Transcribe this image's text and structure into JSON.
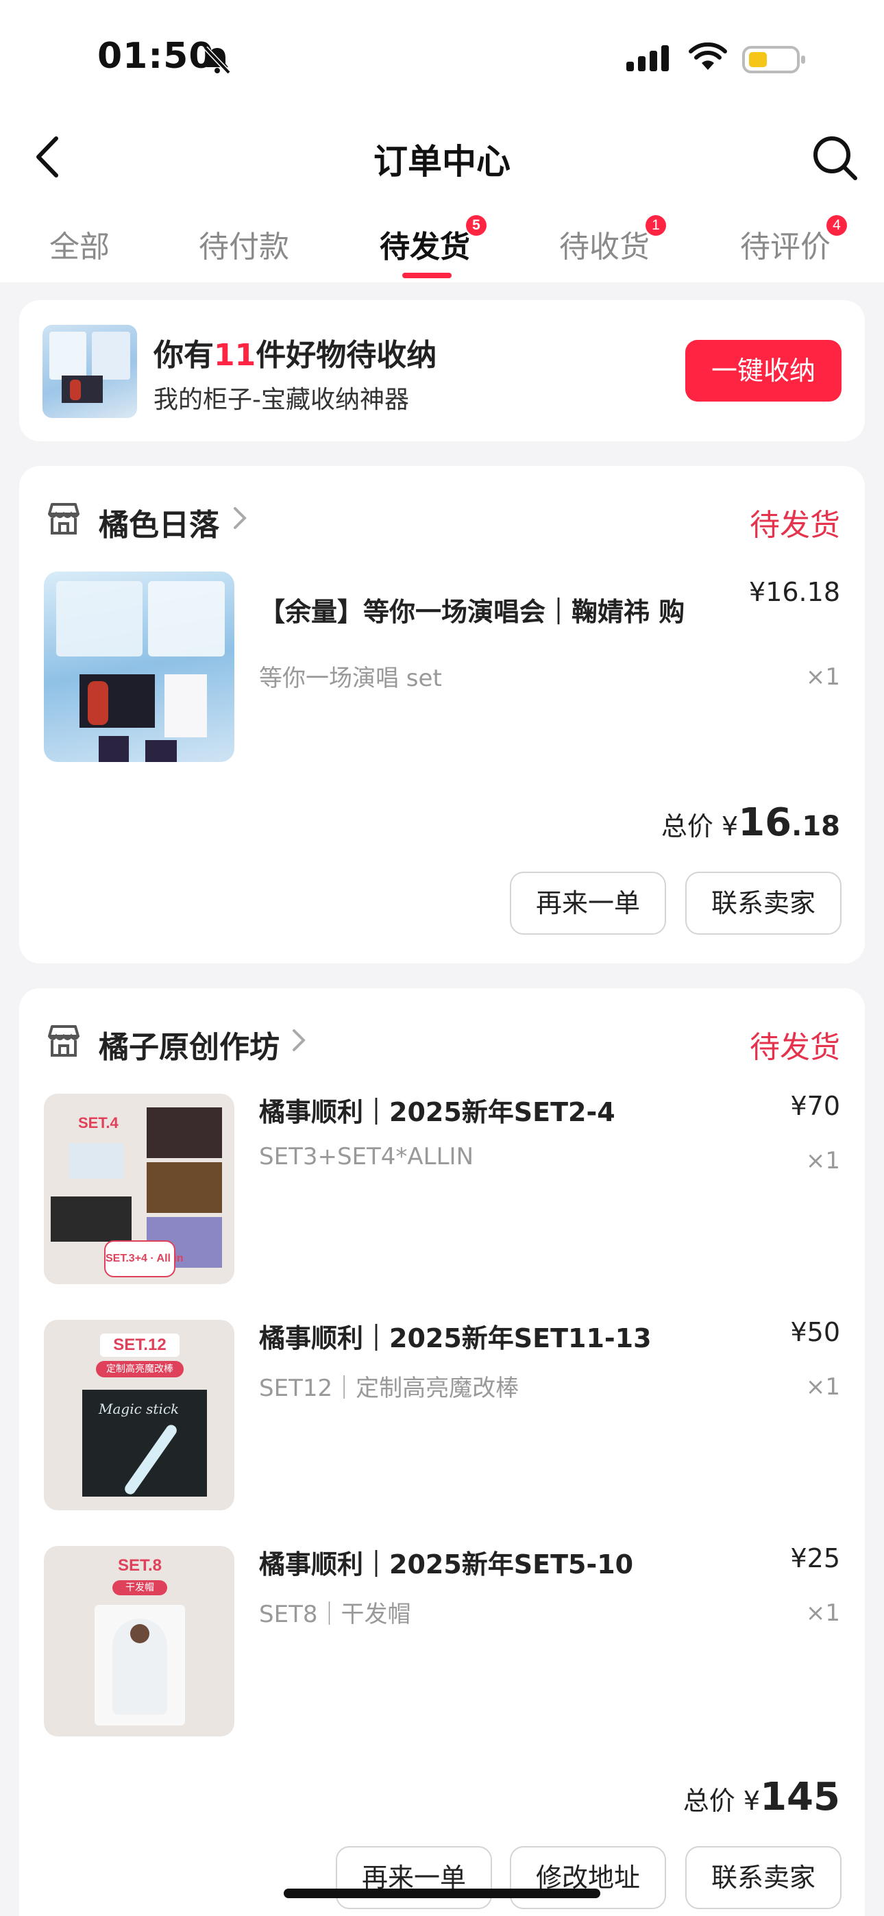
{
  "status_bar": {
    "time": "01:50"
  },
  "header": {
    "title": "订单中心"
  },
  "tabs": [
    {
      "label": "全部",
      "badge": ""
    },
    {
      "label": "待付款",
      "badge": ""
    },
    {
      "label": "待发货",
      "badge": "5"
    },
    {
      "label": "待收货",
      "badge": "1"
    },
    {
      "label": "待评价",
      "badge": "4"
    }
  ],
  "promo": {
    "title_prefix": "你有",
    "title_count": "11",
    "title_suffix": "件好物待收纳",
    "subtitle": "我的柜子-宝藏收纳神器",
    "button": "一键收纳"
  },
  "orders": [
    {
      "shop": "橘色日落",
      "status": "待发货",
      "items": [
        {
          "title": "【余量】等你一场演唱会｜鞠婧祎 购",
          "spec": "等你一场演唱 set",
          "price": "¥16.18",
          "qty": "×1"
        }
      ],
      "total_label": "总价",
      "total_symbol": "¥",
      "total_int": "16",
      "total_dec": ".18",
      "buttons": [
        "再来一单",
        "联系卖家"
      ]
    },
    {
      "shop": "橘子原创作坊",
      "status": "待发货",
      "items": [
        {
          "title": "橘事顺利｜2025新年SET2-4",
          "spec": "SET3+SET4*ALLIN",
          "price": "¥70",
          "qty": "×1",
          "thumb_label": "SET.4",
          "thumb_label2": "SET.3+4 · All in"
        },
        {
          "title": "橘事顺利｜2025新年SET11-13",
          "spec": "SET12｜定制高亮魔改棒",
          "price": "¥50",
          "qty": "×1",
          "thumb_label": "SET.12",
          "thumb_label2": "定制高亮魔改棒",
          "thumb_text": "Magic stick"
        },
        {
          "title": "橘事顺利｜2025新年SET5-10",
          "spec": "SET8｜干发帽",
          "price": "¥25",
          "qty": "×1",
          "thumb_label": "SET.8",
          "thumb_label2": "干发帽"
        }
      ],
      "total_label": "总价",
      "total_symbol": "¥",
      "total_int": "145",
      "buttons": [
        "再来一单",
        "修改地址",
        "联系卖家"
      ]
    }
  ],
  "colors": {
    "accent": "#ff2442",
    "status": "#e6334d",
    "background": "#f4f4f6"
  }
}
